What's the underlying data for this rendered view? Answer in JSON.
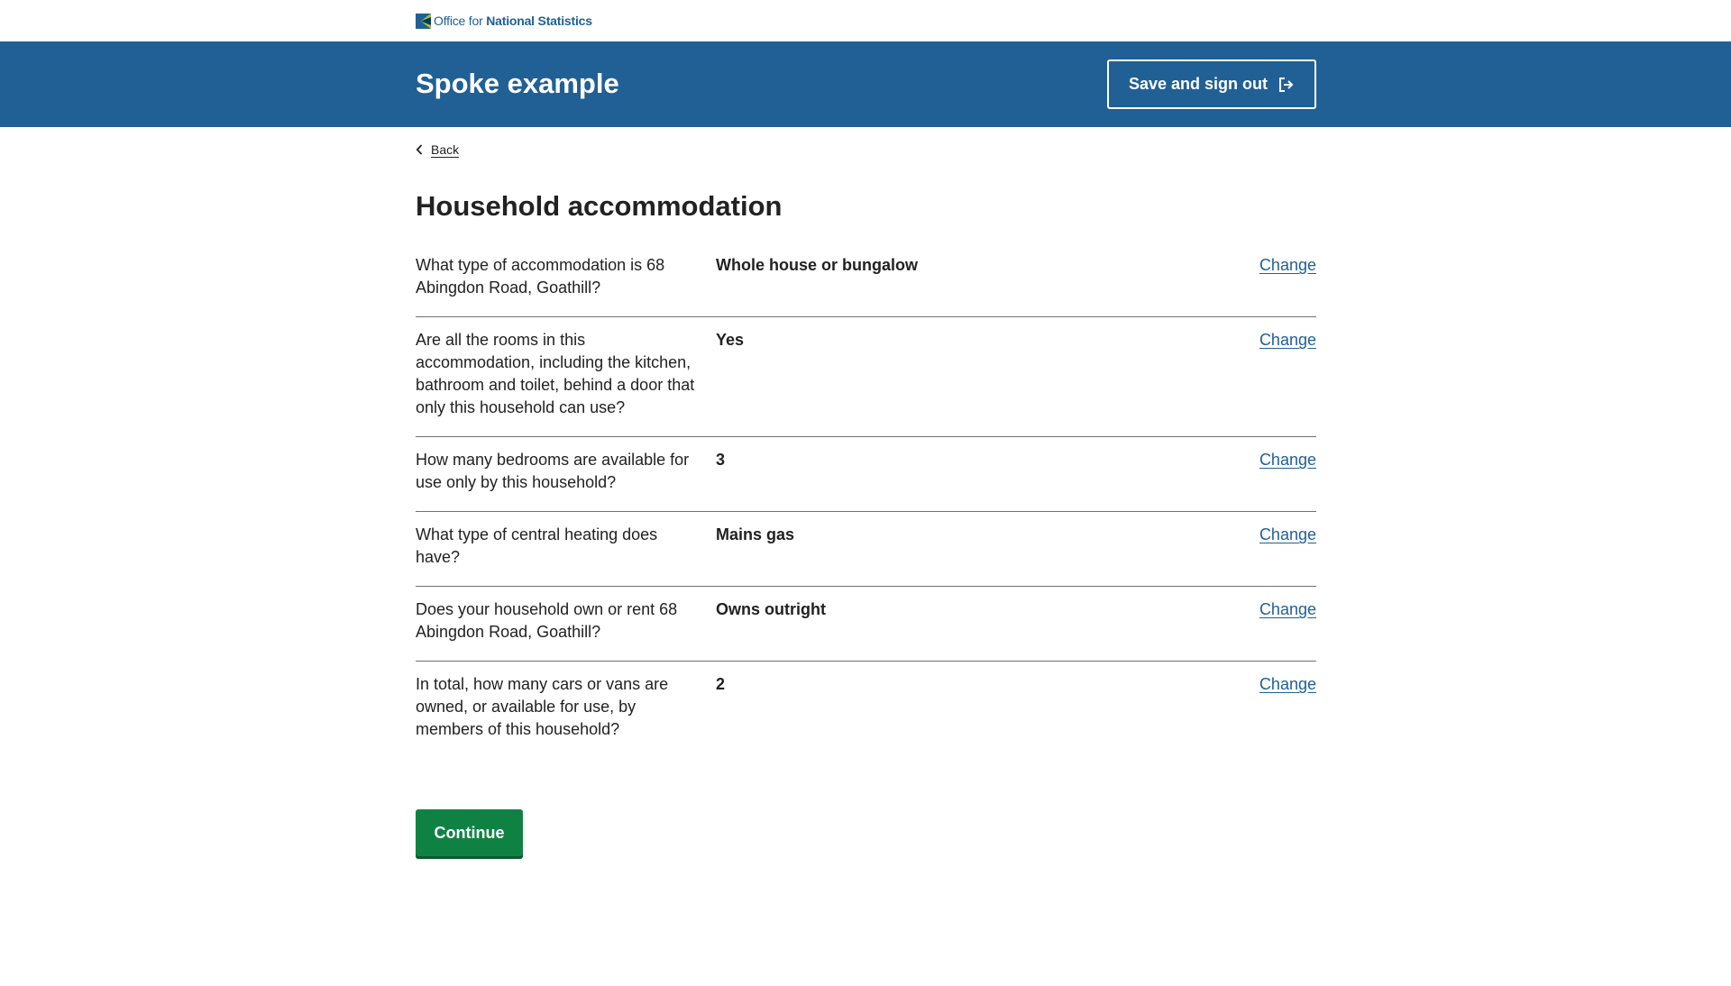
{
  "brand": {
    "logo_prefix": "Office for ",
    "logo_strong": "National Statistics",
    "logo_icon": "ons-logo-icon",
    "primary_color": "#206095",
    "button_color": "#0f8243"
  },
  "header": {
    "title": "Spoke example",
    "signout_label": "Save and sign out",
    "signout_icon": "exit-icon"
  },
  "nav": {
    "back_label": "Back",
    "back_icon": "chevron-left-icon"
  },
  "main": {
    "heading": "Household accommodation",
    "change_label": "Change",
    "rows": [
      {
        "question": "What type of accommodation is 68 Abingdon Road, Goathill?",
        "answer": "Whole house or bungalow"
      },
      {
        "question": "Are all the rooms in this accommodation, including the kitchen, bathroom and toilet, behind a door that only this household can use?",
        "answer": "Yes"
      },
      {
        "question": "How many bedrooms are available for use only by this household?",
        "answer": "3"
      },
      {
        "question": "What type of central heating does have?",
        "answer": "Mains gas"
      },
      {
        "question": "Does your household own or rent 68 Abingdon Road, Goathill?",
        "answer": "Owns outright"
      },
      {
        "question": "In total, how many cars or vans are owned, or available for use, by members of this household?",
        "answer": "2"
      }
    ],
    "continue_label": "Continue"
  }
}
